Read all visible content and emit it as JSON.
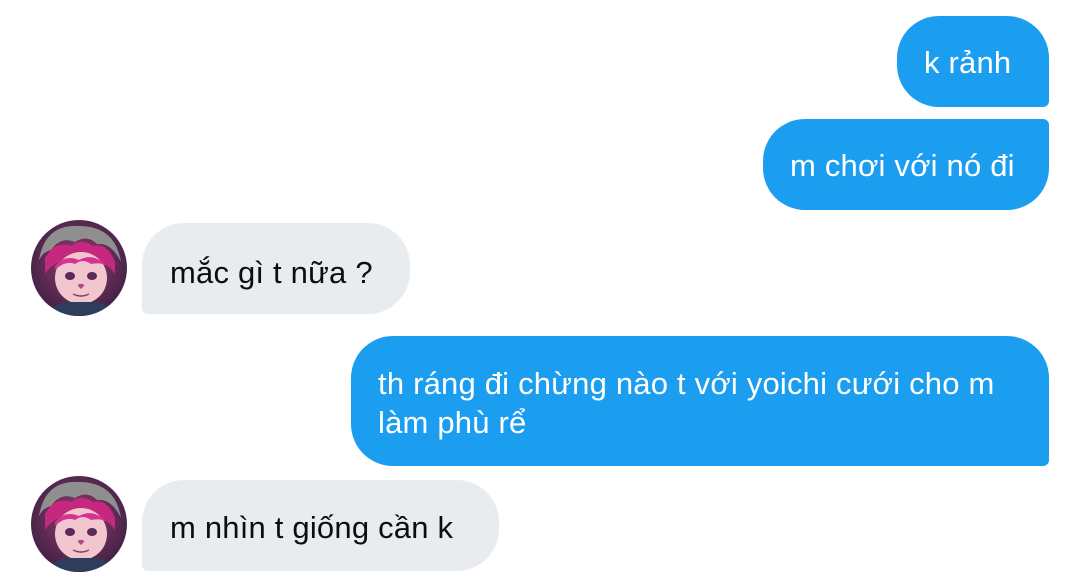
{
  "conversation": {
    "messages": [
      {
        "direction": "outgoing",
        "text": "k rảnh"
      },
      {
        "direction": "outgoing",
        "text": "m chơi với nó đi"
      },
      {
        "direction": "incoming",
        "text": "mắc gì t nữa ?"
      },
      {
        "direction": "outgoing",
        "text": "th ráng đi chừng nào t với yoichi cưới cho m làm phù rể"
      },
      {
        "direction": "incoming",
        "text": "m nhìn t giống cần k"
      }
    ]
  },
  "colors": {
    "outgoing_bubble": "#1c9ef0",
    "incoming_bubble": "#e9ecef",
    "outgoing_text": "#ffffff",
    "incoming_text": "#0d0d0d"
  }
}
